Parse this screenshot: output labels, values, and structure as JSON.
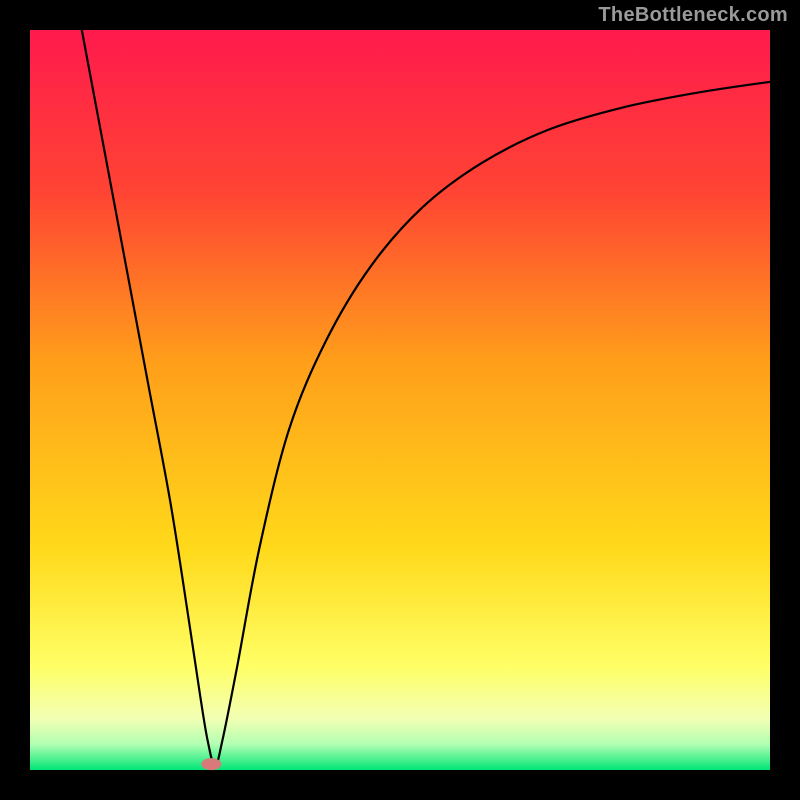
{
  "attribution": "TheBottleneck.com",
  "chart_data": {
    "type": "line",
    "title": "",
    "xlabel": "",
    "ylabel": "",
    "xlim": [
      0,
      100
    ],
    "ylim": [
      0,
      100
    ],
    "axes_visible": false,
    "grid": false,
    "legend": false,
    "background": {
      "type": "vertical-gradient",
      "stops": [
        {
          "pos": 0.0,
          "color": "#ff1a4d"
        },
        {
          "pos": 0.22,
          "color": "#ff4433"
        },
        {
          "pos": 0.45,
          "color": "#ff9f1a"
        },
        {
          "pos": 0.7,
          "color": "#ffd91a"
        },
        {
          "pos": 0.86,
          "color": "#ffff66"
        },
        {
          "pos": 0.93,
          "color": "#f2ffb3"
        },
        {
          "pos": 0.965,
          "color": "#b3ffb3"
        },
        {
          "pos": 1.0,
          "color": "#00e676"
        }
      ]
    },
    "series": [
      {
        "name": "bottleneck-curve",
        "x": [
          7,
          10,
          13,
          16,
          19,
          21.5,
          23,
          24,
          25,
          26,
          28,
          31,
          35,
          40,
          46,
          53,
          61,
          70,
          80,
          90,
          100
        ],
        "y": [
          100,
          84,
          68,
          52,
          36,
          20,
          10,
          4,
          0.5,
          4,
          14,
          30,
          46,
          58,
          68,
          76,
          82,
          86.5,
          89.5,
          91.5,
          93
        ]
      }
    ],
    "annotations": [
      {
        "name": "optimal-point-marker",
        "shape": "rounded-blob",
        "x": 24.5,
        "y": 0.8,
        "color": "#d97a7a"
      }
    ]
  }
}
